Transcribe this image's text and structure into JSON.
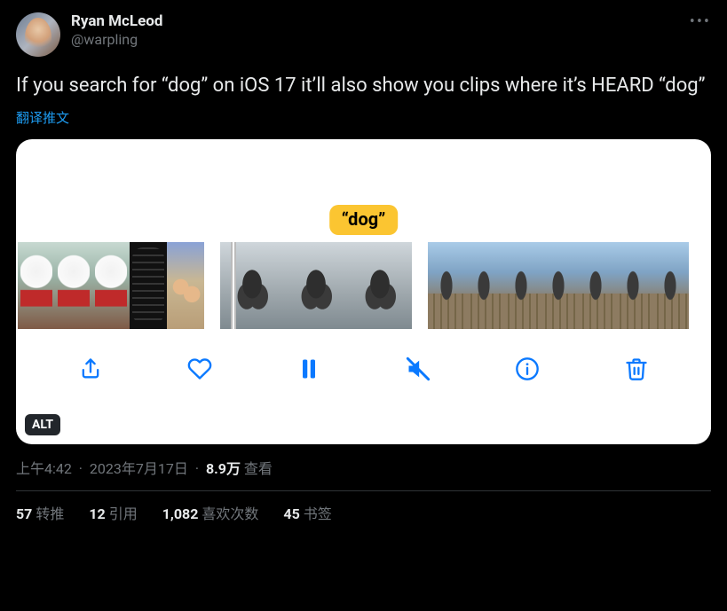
{
  "user": {
    "display_name": "Ryan McLeod",
    "handle": "@warpling"
  },
  "tweet": {
    "text": "If you search for “dog” on iOS 17 it’ll also show you clips where it’s HEARD “dog”",
    "translate_label": "翻译推文"
  },
  "media": {
    "dog_label": "“dog”",
    "alt_badge": "ALT"
  },
  "meta": {
    "time": "上午4:42",
    "date": "2023年7月17日",
    "views_number": "8.9万",
    "views_label": "查看"
  },
  "stats": {
    "retweets": {
      "num": "57",
      "label": "转推"
    },
    "quotes": {
      "num": "12",
      "label": "引用"
    },
    "likes": {
      "num": "1,082",
      "label": "喜欢次数"
    },
    "bookmarks": {
      "num": "45",
      "label": "书签"
    }
  }
}
